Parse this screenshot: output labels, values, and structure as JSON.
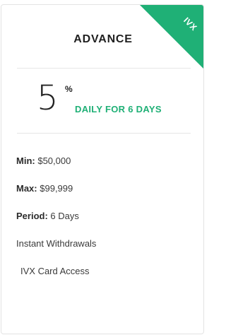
{
  "card": {
    "title": "ADVANCE",
    "ribbon_label": "IVX",
    "accent_color": "#1fb076",
    "rate": {
      "value": "5",
      "unit": "%",
      "caption": "DAILY FOR 6 DAYS"
    },
    "features": [
      {
        "label": "Min:",
        "value": "$50,000"
      },
      {
        "label": "Max:",
        "value": "$99,999"
      },
      {
        "label": "Period:",
        "value": "6 Days"
      },
      {
        "label": "",
        "value": "Instant Withdrawals"
      },
      {
        "label": "",
        "value": "IVX Card Access"
      }
    ]
  }
}
